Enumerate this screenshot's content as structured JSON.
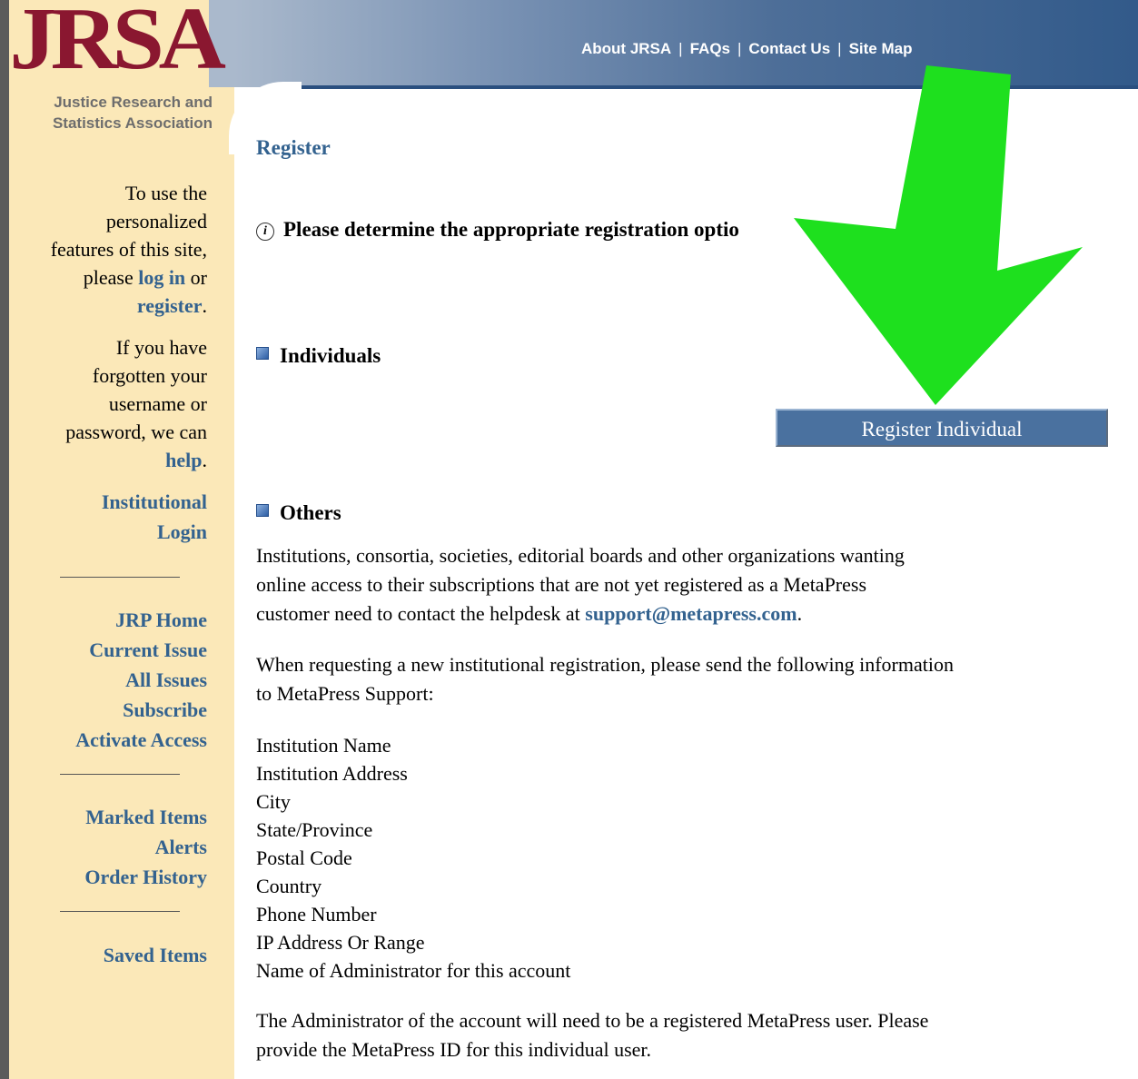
{
  "logo": {
    "text": "JRSA",
    "subtitle_line1": "Justice Research and",
    "subtitle_line2": "Statistics Association"
  },
  "topnav": {
    "items": [
      "About JRSA",
      "FAQs",
      "Contact Us",
      "Site Map"
    ],
    "separator": "|"
  },
  "sidebar": {
    "login_text_1": "To use the",
    "login_text_2": "personalized",
    "login_text_3": "features of this site,",
    "login_text_4a": "please ",
    "login_link": "log in",
    "login_text_4b": " or",
    "register_link": "register",
    "period": ".",
    "forgot_1": "If you have",
    "forgot_2": "forgotten your",
    "forgot_3": "username or",
    "forgot_4": "password, we can",
    "help_link": "help",
    "institutional_1": "Institutional",
    "institutional_2": "Login",
    "nav_group_1": [
      "JRP Home",
      "Current Issue",
      "All Issues",
      "Subscribe",
      "Activate Access"
    ],
    "nav_group_2": [
      "Marked Items",
      "Alerts",
      "Order History"
    ],
    "nav_group_3": [
      "Saved Items"
    ]
  },
  "main": {
    "title": "Register",
    "info_text": "Please determine the appropriate registration optio",
    "individuals_heading": "Individuals",
    "register_button": "Register Individual",
    "others_heading": "Others",
    "others_para_1": "Institutions, consortia, societies, editorial boards and other organizations wanting",
    "others_para_2": "online access to their subscriptions that are not yet registered as a MetaPress",
    "others_para_3a": "customer need to contact the helpdesk at ",
    "support_email": "support@metapress.com",
    "others_para_3b": ".",
    "request_para_1": "When requesting a new institutional registration, please send the following information",
    "request_para_2": "to MetaPress Support:",
    "fields": [
      "Institution Name",
      "Institution Address",
      "City",
      "State/Province",
      "Postal Code",
      "Country",
      "Phone Number",
      "IP Address Or Range",
      "Name of Administrator for this account"
    ],
    "admin_para_1": "The Administrator of the account will need to be a registered MetaPress user. Please",
    "admin_para_2": "provide the MetaPress ID for this individual user."
  },
  "colors": {
    "link": "#33628f",
    "sidebar_bg": "#fbe8b8",
    "logo": "#8a1730",
    "button": "#4a719f",
    "arrow": "#1ee01e"
  },
  "overlay": {
    "icon": "green-down-arrow"
  }
}
